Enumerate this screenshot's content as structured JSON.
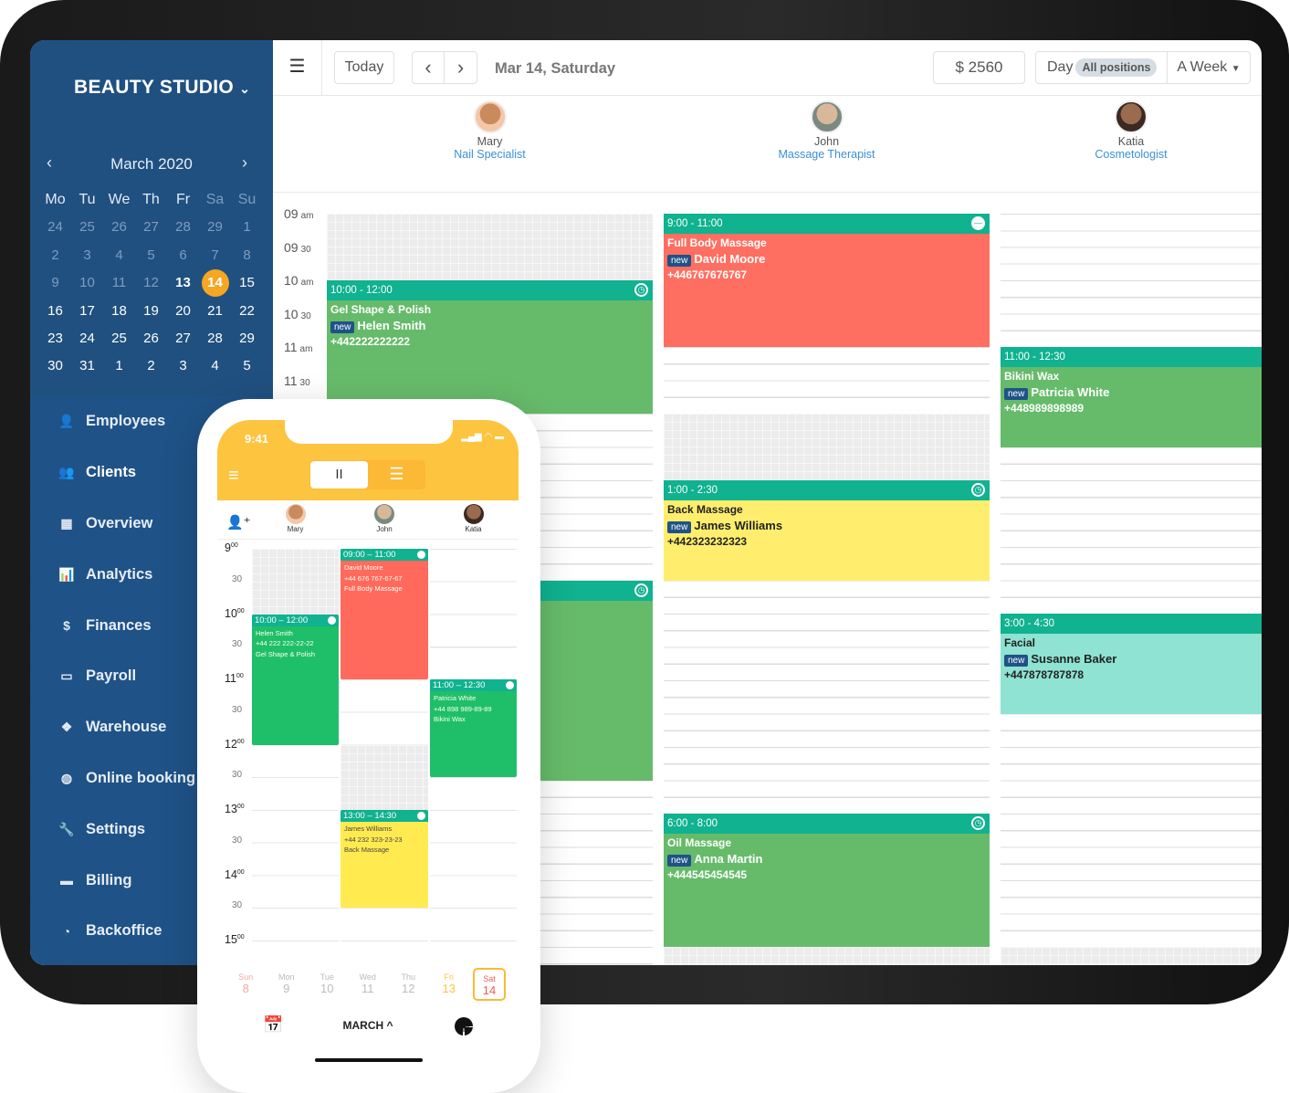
{
  "sidebar": {
    "brand": "BEAUTY STUDIO",
    "brand_chevron_icon": "chevron-down-icon",
    "mini_calendar": {
      "title": "March 2020",
      "weekdays": [
        "Mo",
        "Tu",
        "We",
        "Th",
        "Fr",
        "Sa",
        "Su"
      ],
      "weeks": [
        [
          "24",
          "25",
          "26",
          "27",
          "28",
          "29",
          "1"
        ],
        [
          "2",
          "3",
          "4",
          "5",
          "6",
          "7",
          "8"
        ],
        [
          "9",
          "10",
          "11",
          "12",
          "13",
          "14",
          "15"
        ],
        [
          "16",
          "17",
          "18",
          "19",
          "20",
          "21",
          "22"
        ],
        [
          "23",
          "24",
          "25",
          "26",
          "27",
          "28",
          "29"
        ],
        [
          "30",
          "31",
          "1",
          "2",
          "3",
          "4",
          "5"
        ]
      ],
      "today": "13",
      "selected": "14"
    },
    "menu": [
      {
        "label": "Employees",
        "icon": "user-icon"
      },
      {
        "label": "Clients",
        "icon": "users-icon",
        "active": true
      },
      {
        "label": "Overview",
        "icon": "grid-icon"
      },
      {
        "label": "Analytics",
        "icon": "bar-chart-icon"
      },
      {
        "label": "Finances",
        "icon": "dollar-icon"
      },
      {
        "label": "Payroll",
        "icon": "id-card-icon"
      },
      {
        "label": "Warehouse",
        "icon": "cubes-icon"
      },
      {
        "label": "Online booking",
        "icon": "globe-icon"
      },
      {
        "label": "Settings",
        "icon": "wrench-icon"
      },
      {
        "label": "Billing",
        "icon": "credit-card-icon"
      },
      {
        "label": "Backoffice",
        "icon": "dashboard-icon"
      }
    ]
  },
  "toolbar": {
    "today": "Today",
    "prev": "‹",
    "next": "›",
    "date": "Mar 14, Saturday",
    "revenue": "$ 2560",
    "view_day": "Day",
    "positions": "All positions",
    "range": "A Week"
  },
  "staff": [
    {
      "name": "Mary",
      "position": "Nail Specialist"
    },
    {
      "name": "John",
      "position": "Massage Therapist"
    },
    {
      "name": "Katia",
      "position": "Cosmetologist"
    }
  ],
  "time_labels": [
    {
      "h": "09",
      "m": "am"
    },
    {
      "h": "09",
      "m": "30"
    },
    {
      "h": "10",
      "m": "am"
    },
    {
      "h": "10",
      "m": "30"
    },
    {
      "h": "11",
      "m": "am"
    },
    {
      "h": "11",
      "m": "30"
    }
  ],
  "colors": {
    "header": "#10b290",
    "green": "#66bb6a",
    "red": "#ff6f61",
    "yellow": "#ffee6e",
    "teal": "#8ee3d2",
    "brand": "#1f5287",
    "accent": "#fdc43f"
  },
  "appointments": [
    {
      "staff": 0,
      "start": 10,
      "end": 12,
      "time": "10:00 - 12:00",
      "service": "Gel Shape & Polish",
      "badge": "new",
      "client": "Helen Smith",
      "phone": "+442222222222",
      "color": "#66bb6a",
      "icon": "clock-icon"
    },
    {
      "staff": 0,
      "start": 14.5,
      "end": 17.5,
      "time": "",
      "service": "",
      "badge": "",
      "client": "",
      "phone": "",
      "color": "#66bb6a",
      "icon": "clock-icon"
    },
    {
      "staff": 1,
      "start": 9,
      "end": 11,
      "time": "9:00 - 11:00",
      "service": "Full Body Massage",
      "badge": "new",
      "client": "David Moore",
      "phone": "+446767676767",
      "color": "#ff6f61",
      "icon": "minus-circle-icon"
    },
    {
      "staff": 1,
      "start": 13,
      "end": 14.5,
      "time": "1:00 - 2:30",
      "service": "Back Massage",
      "badge": "new",
      "client": "James Williams",
      "phone": "+442323232323",
      "color": "#ffee6e",
      "icon": "clock-icon",
      "dark": true
    },
    {
      "staff": 1,
      "start": 18,
      "end": 20,
      "time": "6:00 - 8:00",
      "service": "Oil Massage",
      "badge": "new",
      "client": "Anna Martin",
      "phone": "+444545454545",
      "color": "#66bb6a",
      "icon": "clock-icon"
    },
    {
      "staff": 2,
      "start": 11,
      "end": 12.5,
      "time": "11:00 - 12:30",
      "service": "Bikini Wax",
      "badge": "new",
      "client": "Patricia White",
      "phone": "+448989898989",
      "color": "#66bb6a",
      "icon": ""
    },
    {
      "staff": 2,
      "start": 15,
      "end": 16.5,
      "time": "3:00 - 4:30",
      "service": "Facial",
      "badge": "new",
      "client": "Susanne Baker",
      "phone": "+447878787878",
      "color": "#8ee3d2",
      "icon": "",
      "dark": true
    }
  ],
  "blocked": [
    {
      "staff": 0,
      "start": 9,
      "end": 10
    },
    {
      "staff": 1,
      "start": 12,
      "end": 13
    },
    {
      "staff": 1,
      "start": 20,
      "end": 21
    },
    {
      "staff": 2,
      "start": 20,
      "end": 21
    }
  ],
  "phone": {
    "clock": "9:41",
    "status": "▂▄▆ ◠ ▬",
    "seg_left": "II",
    "seg_right": "☰",
    "staff": [
      "Mary",
      "John",
      "Katia"
    ],
    "time_labels": [
      {
        "t": "9",
        "s": "00",
        "h": true
      },
      {
        "t": "30"
      },
      {
        "t": "10",
        "s": "00",
        "h": true
      },
      {
        "t": "30"
      },
      {
        "t": "11",
        "s": "00",
        "h": true
      },
      {
        "t": "30"
      },
      {
        "t": "12",
        "s": "00",
        "h": true
      },
      {
        "t": "30"
      },
      {
        "t": "13",
        "s": "00",
        "h": true
      },
      {
        "t": "30"
      },
      {
        "t": "14",
        "s": "00",
        "h": true
      },
      {
        "t": "30"
      },
      {
        "t": "15",
        "s": "00",
        "h": true
      }
    ],
    "appointments": [
      {
        "staff": 0,
        "start": 10,
        "end": 12,
        "time": "10:00 – 12:00",
        "lines": [
          "Helen Smith",
          "+44 222 222-22-22",
          "Gel Shape & Polish"
        ],
        "color": "#1fbf6a"
      },
      {
        "staff": 1,
        "start": 9,
        "end": 11,
        "time": "09:00 – 11:00",
        "lines": [
          "David Moore",
          "+44 676 767-67-67",
          "Full Body Massage"
        ],
        "color": "#ff6a5c"
      },
      {
        "staff": 2,
        "start": 11,
        "end": 12.5,
        "time": "11:00 – 12:30",
        "lines": [
          "Patricia White",
          "+44 898 989-89-89",
          "Bikini Wax"
        ],
        "color": "#1fbf6a"
      },
      {
        "staff": 1,
        "start": 13,
        "end": 14.5,
        "time": "13:00 – 14:30",
        "lines": [
          "James Williams",
          "+44 232 323-23-23",
          "Back Massage"
        ],
        "color": "#ffeb50",
        "dark": true
      }
    ],
    "blocked": [
      {
        "staff": 0,
        "start": 9,
        "end": 10
      },
      {
        "staff": 1,
        "start": 12,
        "end": 13
      }
    ],
    "days": [
      {
        "d": "Sun",
        "n": "8",
        "c": "#f7a8a0"
      },
      {
        "d": "Mon",
        "n": "9"
      },
      {
        "d": "Tue",
        "n": "10"
      },
      {
        "d": "Wed",
        "n": "11"
      },
      {
        "d": "Thu",
        "n": "12"
      },
      {
        "d": "Fri",
        "n": "13",
        "c": "#fdc43f"
      },
      {
        "d": "Sat",
        "n": "14",
        "c": "#f25c54",
        "sel": true
      }
    ],
    "month": "MARCH ^"
  }
}
